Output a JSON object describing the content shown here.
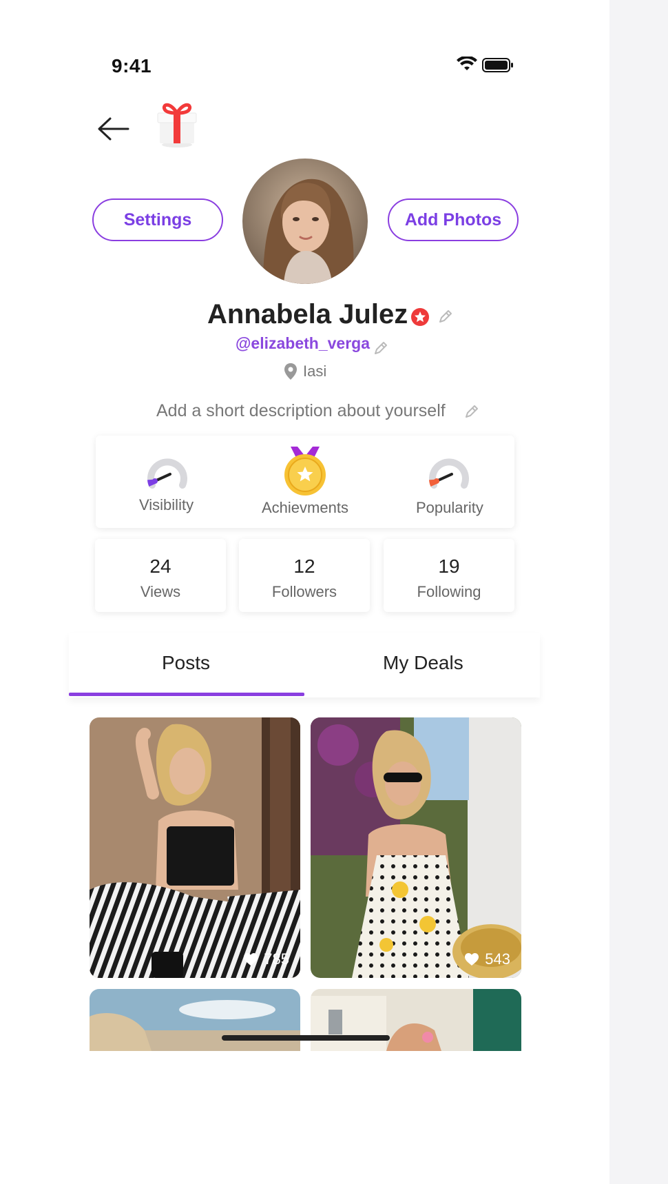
{
  "status": {
    "time": "9:41"
  },
  "header": {
    "back_icon": "arrow-left-icon",
    "gift_icon": "gift-icon"
  },
  "profile": {
    "settings_label": "Settings",
    "add_photos_label": "Add Photos",
    "name": "Annabela Julez",
    "handle": "@elizabeth_verga",
    "location": "Iasi",
    "description": "Add a short description about yourself"
  },
  "indicators": [
    {
      "label": "Visibility",
      "accent": "#7c3fe4"
    },
    {
      "label": "Achievments",
      "accent": "#f5b82e"
    },
    {
      "label": "Popularity",
      "accent": "#f2603a"
    }
  ],
  "counts": [
    {
      "value": "24",
      "label": "Views"
    },
    {
      "value": "12",
      "label": "Followers"
    },
    {
      "value": "19",
      "label": "Following"
    }
  ],
  "tabs": [
    {
      "label": "Posts",
      "active": true
    },
    {
      "label": "My Deals",
      "active": false
    }
  ],
  "posts": [
    {
      "likes": "785"
    },
    {
      "likes": "543"
    },
    {
      "likes": ""
    },
    {
      "likes": ""
    }
  ],
  "colors": {
    "brand": "#8a3ee0",
    "text": "#222222",
    "muted": "#777777"
  }
}
